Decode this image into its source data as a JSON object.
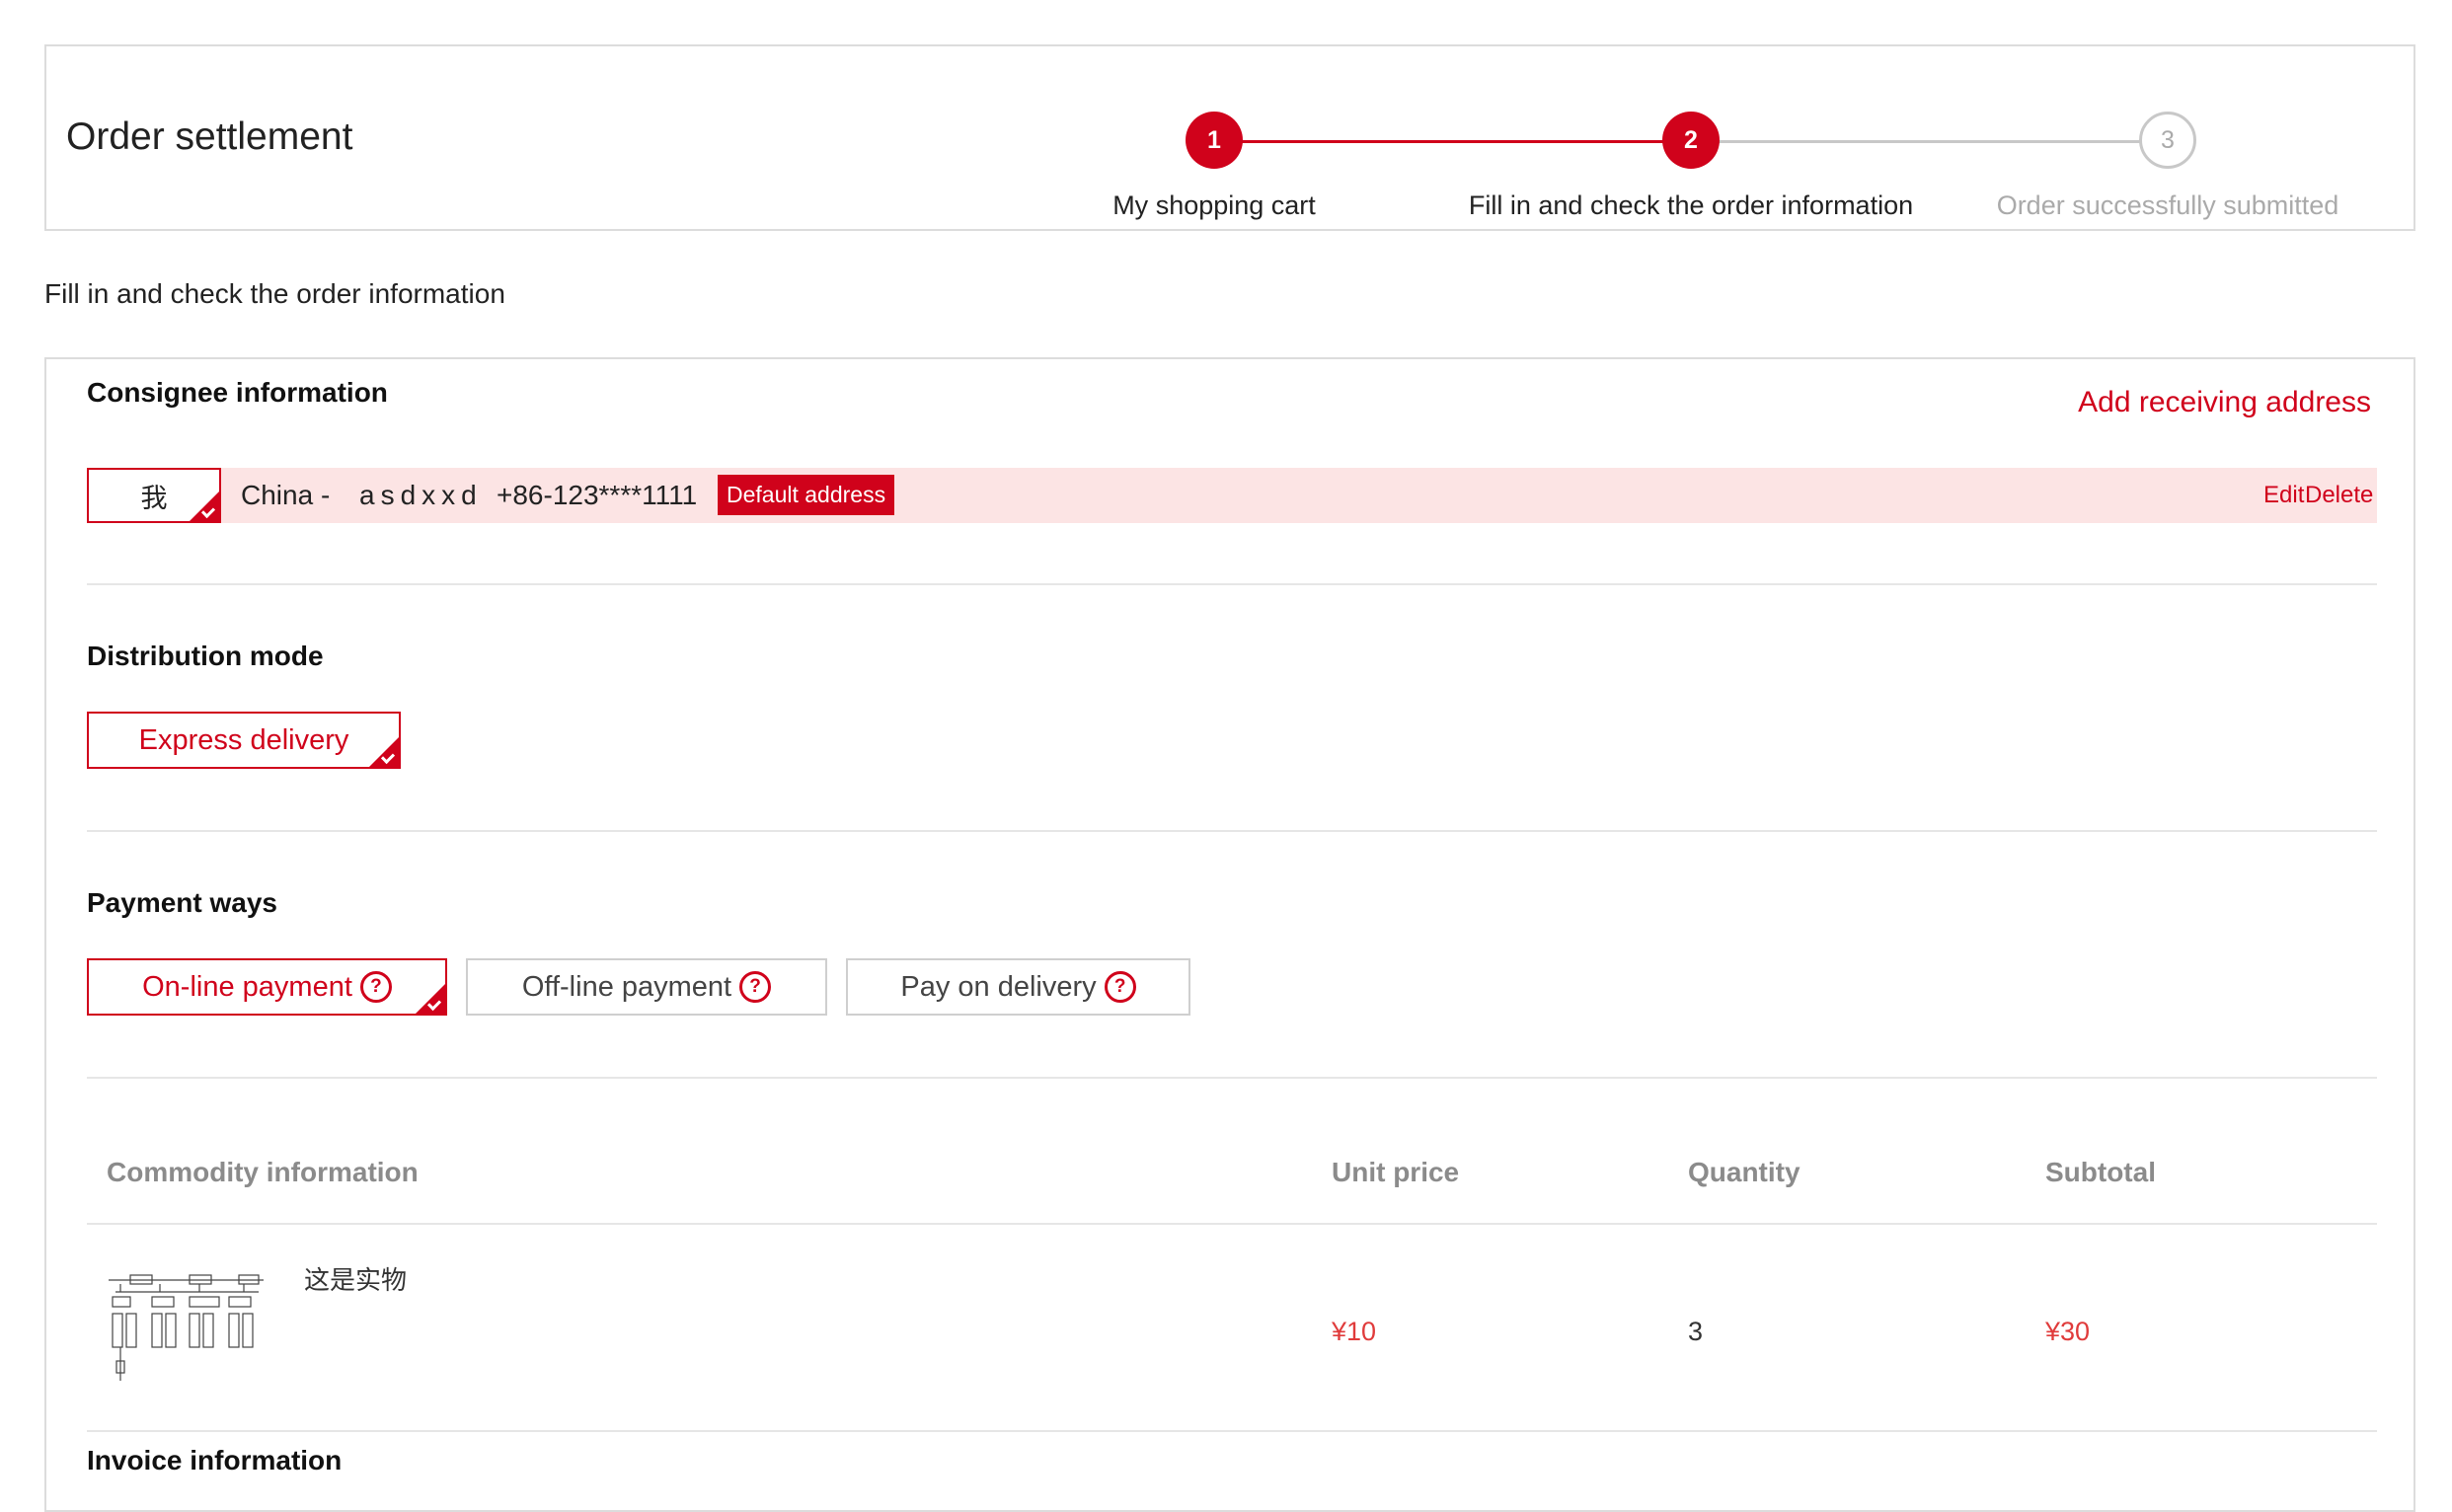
{
  "header": {
    "title": "Order settlement",
    "steps": [
      {
        "number": "1",
        "label": "My shopping cart",
        "state": "done"
      },
      {
        "number": "2",
        "label": "Fill in and check the order information",
        "state": "current"
      },
      {
        "number": "3",
        "label": "Order successfully submitted",
        "state": "pending"
      }
    ]
  },
  "section_heading": "Fill in and check the order information",
  "consignee": {
    "title": "Consignee information",
    "add_address_label": "Add receiving address",
    "address": {
      "name": "我",
      "region": "China -",
      "detail": "asdxxd",
      "phone": "+86-123****1111",
      "default_badge": "Default address",
      "edit_label": "Edit",
      "delete_label": "Delete"
    }
  },
  "distribution": {
    "title": "Distribution mode",
    "options": [
      {
        "label": "Express delivery",
        "selected": true
      }
    ]
  },
  "payment": {
    "title": "Payment ways",
    "options": [
      {
        "label": "On-line payment",
        "selected": true
      },
      {
        "label": "Off-line payment",
        "selected": false
      },
      {
        "label": "Pay on delivery",
        "selected": false
      }
    ],
    "help_glyph": "?"
  },
  "commodity": {
    "columns": [
      "Commodity information",
      "Unit price",
      "Quantity",
      "Subtotal"
    ],
    "rows": [
      {
        "name": "这是实物",
        "unit_price": "¥10",
        "quantity": "3",
        "subtotal": "¥30",
        "thumb_icon": "org-chart-thumbnail"
      }
    ]
  },
  "invoice": {
    "title": "Invoice information"
  },
  "colors": {
    "accent": "#d0021b",
    "price": "#e03b3b",
    "address_highlight": "#fce4e4",
    "inactive_step": "#aaaaaa"
  }
}
